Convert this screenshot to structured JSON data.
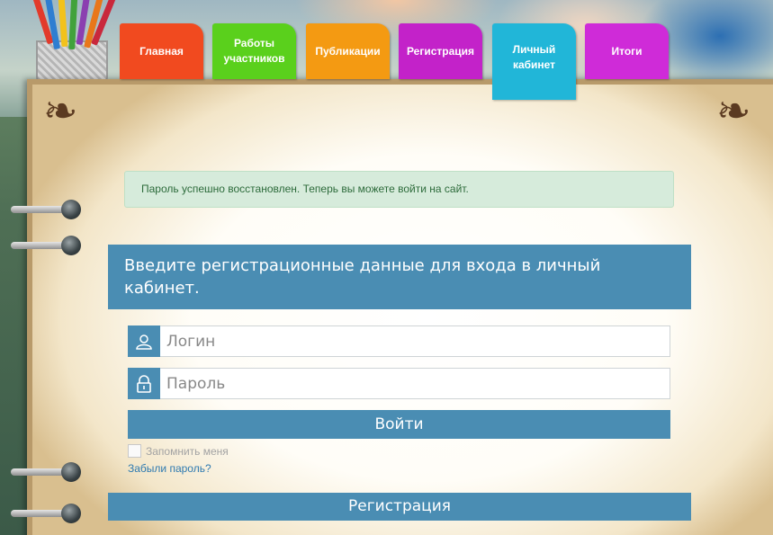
{
  "nav": {
    "tabs": [
      {
        "label": "Главная",
        "color": "#f14a1f"
      },
      {
        "label": "Работы участников",
        "color": "#5ad01c"
      },
      {
        "label": "Публикации",
        "color": "#f49a12"
      },
      {
        "label": "Регистрация",
        "color": "#c322c9"
      },
      {
        "label": "Личный кабинет",
        "color": "#21b6d8",
        "active": true
      },
      {
        "label": "Итоги",
        "color": "#cf2bd8"
      }
    ]
  },
  "alert": {
    "text": "Пароль успешно восстановлен. Теперь вы можете войти на сайт."
  },
  "login": {
    "heading": "Введите регистрационные данные для входа в личный кабинет.",
    "login_placeholder": "Логин",
    "password_placeholder": "Пароль",
    "submit_label": "Войти",
    "remember_label": "Запомнить меня",
    "forgot_label": "Забыли пароль?",
    "register_label": "Регистрация"
  },
  "colors": {
    "accent": "#4a8db3",
    "alert_bg": "#d6ebdb"
  }
}
